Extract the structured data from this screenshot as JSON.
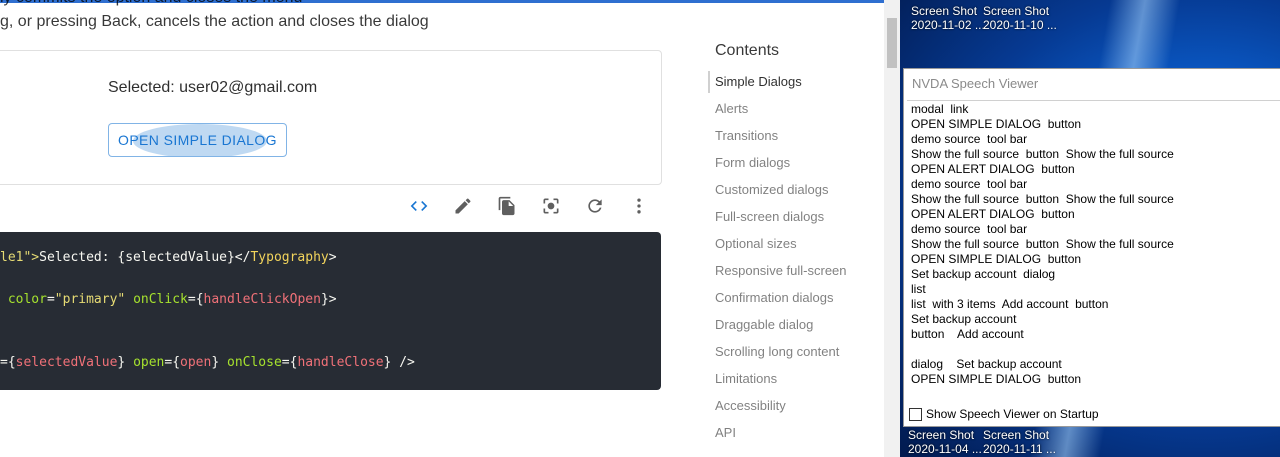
{
  "doc": {
    "cut_line": "ly commits the option and closes the menu",
    "line2": "g, or pressing Back, cancels the action and closes the dialog"
  },
  "demo": {
    "selected_text": "Selected: user02@gmail.com",
    "open_button_label": "OPEN SIMPLE DIALOG"
  },
  "toolbar_icons": [
    "code-icon",
    "edit-icon",
    "copy-icon",
    "screenshot-icon",
    "refresh-icon",
    "more-vert-icon"
  ],
  "code": {
    "line1": {
      "a": "le1\">",
      "b": "Selected: {selectedValue}</",
      "c": "Typography",
      "d": ">"
    },
    "line2": {
      "a": " color",
      "b": "=",
      "c": "\"primary\"",
      "d": " onClick",
      "e": "={",
      "f": "handleClickOpen",
      "g": "}>"
    },
    "line3": {
      "a": "={",
      "b": "selectedValue",
      "c": "} ",
      "d": "open",
      "e": "={",
      "f": "open",
      "g": "} ",
      "h": "onClose",
      "i": "={",
      "j": "handleClose",
      "k": "} />"
    }
  },
  "contents": {
    "title": "Contents",
    "items": [
      "Simple Dialogs",
      "Alerts",
      "Transitions",
      "Form dialogs",
      "Customized dialogs",
      "Full-screen dialogs",
      "Optional sizes",
      "Responsive full-screen",
      "Confirmation dialogs",
      "Draggable dialog",
      "Scrolling long content",
      "Limitations",
      "Accessibility",
      "API"
    ],
    "active_index": 0
  },
  "desktop": {
    "icons_top": [
      {
        "line1": "Screen Shot",
        "line2": "2020-11-02 ..."
      },
      {
        "line1": "Screen Shot",
        "line2": "2020-11-10 ..."
      }
    ],
    "icons_bottom": [
      {
        "line1": "Screen Shot",
        "line2": "2020-11-04 ..."
      },
      {
        "line1": "Screen Shot",
        "line2": "2020-11-11 ..."
      }
    ]
  },
  "nvda": {
    "title": "NVDA Speech Viewer",
    "lines": [
      "modal  link",
      "OPEN SIMPLE DIALOG  button",
      "demo source  tool bar",
      "Show the full source  button  Show the full source",
      "OPEN ALERT DIALOG  button",
      "demo source  tool bar",
      "Show the full source  button  Show the full source",
      "OPEN ALERT DIALOG  button",
      "demo source  tool bar",
      "Show the full source  button  Show the full source",
      "OPEN SIMPLE DIALOG  button",
      "Set backup account  dialog",
      "list",
      "list  with 3 items  Add account  button",
      "Set backup account",
      "button    Add account",
      "",
      "dialog    Set backup account",
      "OPEN SIMPLE DIALOG  button"
    ],
    "footer_label": "Show Speech Viewer on Startup",
    "footer_checked": false
  }
}
